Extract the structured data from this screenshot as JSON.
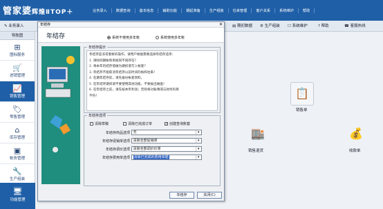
{
  "app": {
    "logo_main": "管家婆",
    "logo_sub": "辉煌ⅡTOP＋"
  },
  "menu": [
    "业务录入",
    "数据查询",
    "基本信息",
    "辅助功能",
    "期起准备",
    "生产组装",
    "往来管理",
    "客户关系",
    "系统维护",
    "帮助"
  ],
  "toolbar": {
    "left_btn": "业务录入",
    "right_btns": [
      "期初数据",
      "生产组装",
      "系统维护",
      "帮助",
      "客服热线"
    ]
  },
  "sidebar": {
    "header": "导航图",
    "items": [
      {
        "label": "图标服务",
        "icon": "grid-icon"
      },
      {
        "label": "进销管理",
        "icon": "cart-icon"
      },
      {
        "label": "销售管理",
        "icon": "chart-icon",
        "active": true
      },
      {
        "label": "零售管理",
        "icon": "tag-icon"
      },
      {
        "label": "库存管理",
        "icon": "warehouse-icon"
      },
      {
        "label": "帐务管理",
        "icon": "ledger-icon"
      },
      {
        "label": "生产组装",
        "icon": "wrench-icon"
      }
    ],
    "bottom": "功能管理"
  },
  "dialog": {
    "window_title": "年结存",
    "heading": "年结存",
    "radio_single": "系统不使用多年帐",
    "radio_multi": "系统使用多年帐",
    "tip_legend": "年结存提示",
    "tips": [
      "年结存是非常重要的操作，请用户根据需要选择年结存选项：",
      "1. 清除同期帐和单据同不再存在？",
      "2. 将本年的结存值做为期初值写入帐套？",
      "3. 年结存不能取消年结存以前时间的帐和往来！",
      "4. 在期年结存前，请先备份帐套资料。",
      "5. 在年结存期间请不要使用其他功能，不要拔出磁盘！",
      "6. 在年结存之前，请先核本年利润；否则将对账簿或与财务科目",
      "   不符！"
    ],
    "options_legend": "年结存选项",
    "chk_clear_draft": "清除草稿",
    "chk_clear_done": "清除已完成订单",
    "chk_create_check": "创建查询账套",
    "rows": [
      {
        "label": "年结存商品选项",
        "value": "无"
      },
      {
        "label": "年结存促销单选项",
        "value": "清除全部促销单"
      },
      {
        "label": "年结存调价选项",
        "value": "清除全部调价价单"
      },
      {
        "label": "年结存费用单选项",
        "value": "清除已完成的费用单据"
      }
    ],
    "ok_btn": "年结存",
    "close_btn": "关闭(C)"
  },
  "workspace": [
    {
      "label": "销售单",
      "icon": "doc-check-icon"
    },
    {
      "label": "销售退货",
      "icon": "return-icon"
    },
    {
      "label": "收款单",
      "icon": "money-bag-icon"
    }
  ]
}
